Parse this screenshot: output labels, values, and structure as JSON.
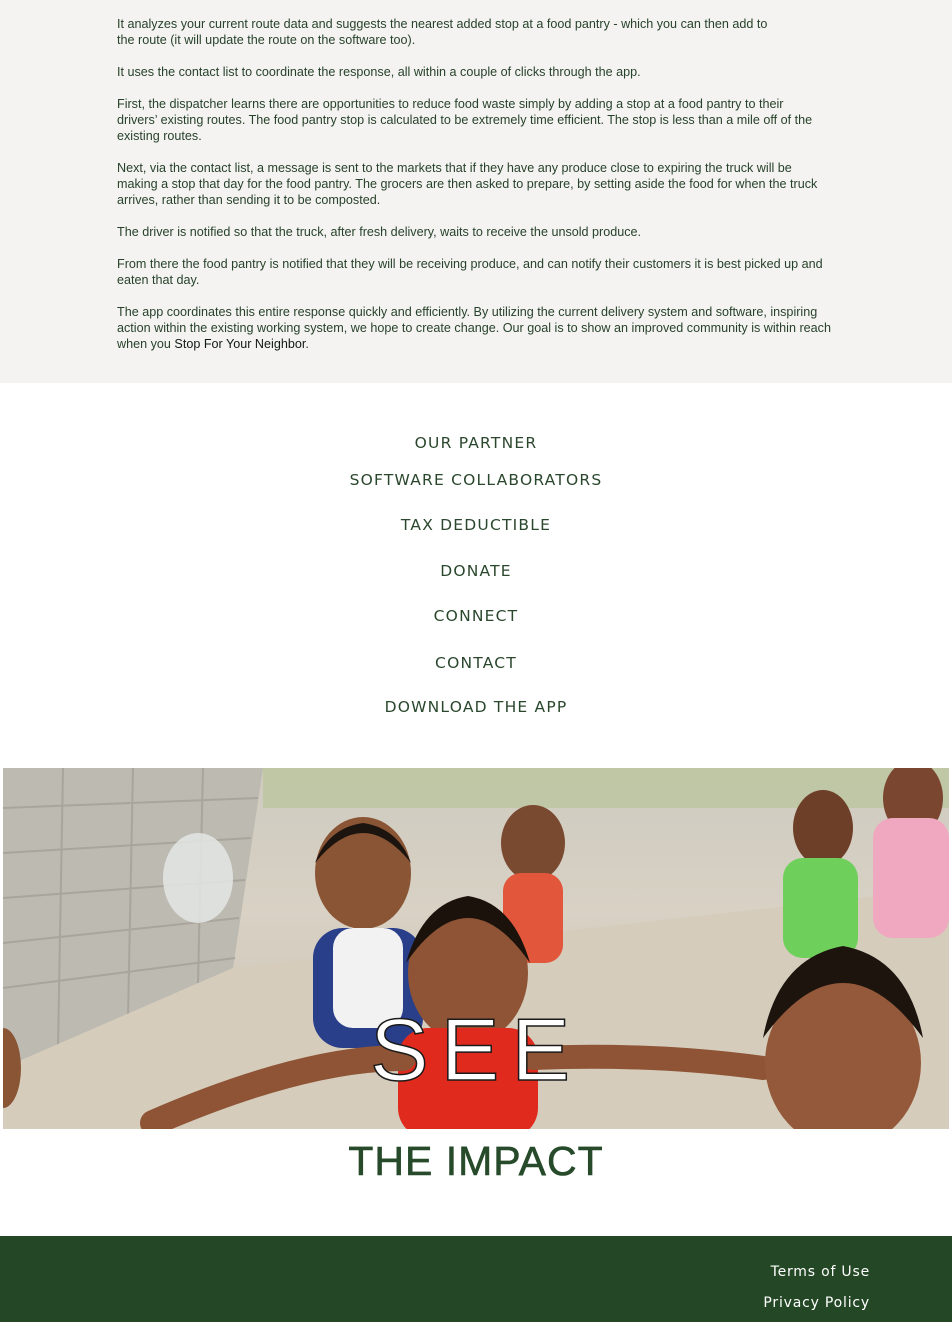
{
  "intro": {
    "paragraphs": [
      "It analyzes your current route data and suggests the nearest added stop at a food pantry - which you can then add to the route (it will update the route on the software too).",
      "It uses the contact list to coordinate the response, all within a couple of clicks through the app.",
      "First, the dispatcher learns there are opportunities to reduce food waste simply by adding a stop at a food pantry to their drivers’ existing routes. The food pantry stop is calculated to be extremely time efficient. The stop is less than a mile off of the existing routes.",
      "Next, via the contact list, a message is sent to the markets that if they have any produce close to expiring the truck will be making a stop that day for the food pantry. The grocers are then asked to prepare, by setting aside the food for when the truck arrives, rather than sending it to be composted.",
      "The driver is notified so that the truck, after fresh delivery, waits to receive the unsold produce.",
      "From there the food pantry is notified that they will be receiving produce, and can notify their customers it is best picked up and eaten that day."
    ],
    "last_paragraph_prefix": "The app coordinates this entire response quickly and efficiently. By utilizing the current delivery system and software, inspiring action within the existing working system, we hope to create change. Our goal is to show an improved community is within reach when you ",
    "last_paragraph_emphasis": "Stop For Your Neighbor",
    "last_paragraph_suffix": "."
  },
  "nav_links": {
    "our_partner": "OUR PARTNER",
    "software_collaborators": "SOFTWARE COLLABORATORS",
    "tax_deductible": "TAX DEDUCTIBLE",
    "donate": "DONATE",
    "connect": "CONNECT",
    "contact": "CONTACT",
    "download_app": "DOWNLOAD THE APP"
  },
  "hero": {
    "overlay_text": "SEE",
    "subtitle": "THE  IMPACT"
  },
  "footer": {
    "terms": "Terms of Use",
    "privacy": "Privacy Policy"
  },
  "colors": {
    "intro_bg": "#f4f3f1",
    "text_green": "#27422a",
    "footer_bg": "#244826"
  }
}
